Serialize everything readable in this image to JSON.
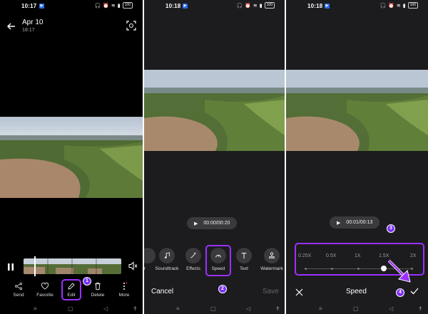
{
  "panel1": {
    "time": "10:17",
    "battery": "100",
    "date": "Apr 10",
    "clock": "18:17",
    "actions": [
      {
        "label": "Send",
        "icon": "share-icon"
      },
      {
        "label": "Favorite",
        "icon": "heart-icon"
      },
      {
        "label": "Edit",
        "icon": "pencil-icon"
      },
      {
        "label": "Delete",
        "icon": "trash-icon"
      },
      {
        "label": "More",
        "icon": "more-vertical-icon"
      }
    ],
    "callout": "1"
  },
  "panel2": {
    "time": "10:18",
    "battery": "100",
    "playback": "00:00/00:20",
    "tools": [
      {
        "label": "Soundtrack",
        "icon": "music-note-icon"
      },
      {
        "label": "Effects",
        "icon": "magic-wand-icon"
      },
      {
        "label": "Speed",
        "icon": "speedometer-icon"
      },
      {
        "label": "Text",
        "icon": "text-icon"
      },
      {
        "label": "Watermark",
        "icon": "stamp-icon"
      }
    ],
    "partial_tool_label": "r",
    "cancel": "Cancel",
    "save": "Save",
    "callout": "2"
  },
  "panel3": {
    "time": "10:18",
    "battery": "100",
    "playback": "00:01/00:13",
    "speed_options": [
      "0.25X",
      "0.5X",
      "1X",
      "1.5X",
      "2X"
    ],
    "selected_speed": "1.5X",
    "title": "Speed",
    "callout_slider": "3",
    "callout_confirm": "4"
  },
  "colors": {
    "accent": "#9b30ff",
    "callout": "#7b2ff7"
  }
}
